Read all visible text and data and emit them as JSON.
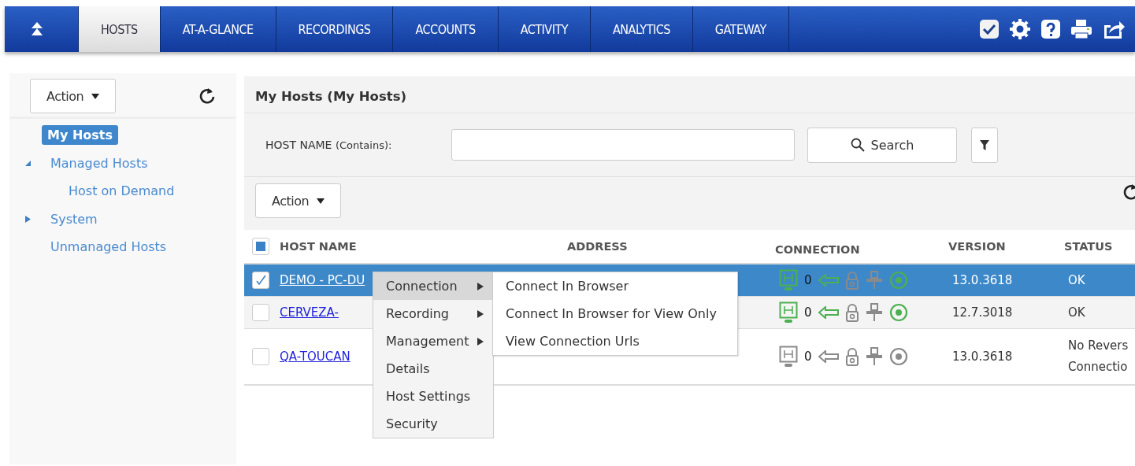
{
  "nav": {
    "tabs": [
      {
        "label": "HOSTS",
        "selected": true
      },
      {
        "label": "AT-A-GLANCE",
        "selected": false
      },
      {
        "label": "RECORDINGS",
        "selected": false
      },
      {
        "label": "ACCOUNTS",
        "selected": false
      },
      {
        "label": "ACTIVITY",
        "selected": false
      },
      {
        "label": "ANALYTICS",
        "selected": false
      },
      {
        "label": "GATEWAY",
        "selected": false
      }
    ]
  },
  "sidebar": {
    "action_label": "Action",
    "items": [
      {
        "label": "My Hosts",
        "selected": true
      },
      {
        "label": "Managed Hosts",
        "selected": false,
        "expanded": true,
        "children": [
          {
            "label": "Host on Demand",
            "selected": false
          }
        ]
      },
      {
        "label": "System",
        "selected": false,
        "expanded": false
      },
      {
        "label": "Unmanaged Hosts",
        "selected": false
      }
    ]
  },
  "main": {
    "title": "My Hosts (My Hosts)",
    "filter_label": "HOST NAME",
    "filter_hint": "(Contains):",
    "search_label": "Search",
    "action_label": "Action"
  },
  "table": {
    "partially_checked": true,
    "columns": [
      "HOST NAME",
      "ADDRESS",
      "CONNECTION",
      "VERSION",
      "STATUS"
    ],
    "rows": [
      {
        "name": "DEMO - PC-DU",
        "checked": true,
        "selected": true,
        "active": true,
        "count": "0",
        "version": "13.0.3618",
        "status": "OK"
      },
      {
        "name": "CERVEZA-",
        "checked": false,
        "selected": false,
        "active": true,
        "count": "0",
        "version": "12.7.3018",
        "status": "OK"
      },
      {
        "name": "QA-TOUCAN",
        "checked": false,
        "selected": false,
        "active": false,
        "count": "0",
        "version": "13.0.3618",
        "status": "No Revers Connectio"
      }
    ]
  },
  "context_menu": {
    "items": [
      {
        "label": "Connection",
        "submenu": true,
        "selected": true
      },
      {
        "label": "Recording",
        "submenu": true,
        "selected": false
      },
      {
        "label": "Management",
        "submenu": true,
        "selected": false
      },
      {
        "label": "Details",
        "submenu": false,
        "selected": false
      },
      {
        "label": "Host Settings",
        "submenu": false,
        "selected": false
      },
      {
        "label": "Security",
        "submenu": false,
        "selected": false
      }
    ],
    "submenu": [
      "Connect In Browser",
      "Connect In Browser for View Only",
      "View Connection Urls"
    ]
  }
}
